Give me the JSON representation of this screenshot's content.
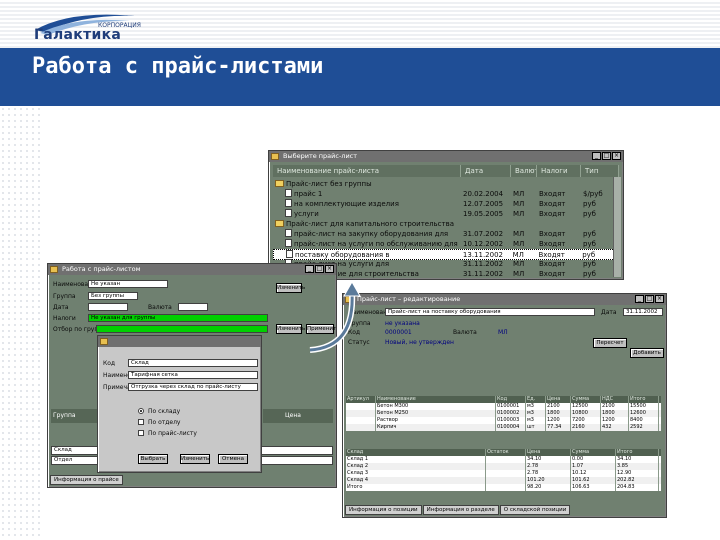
{
  "slide": {
    "logo_small": "КОРПОРАЦИЯ",
    "logo_text": "Галактика",
    "title": "Работа с прайс-листами"
  },
  "price_window": {
    "title": "Выберите прайс-лист",
    "columns": [
      "Наименование прайс-листа",
      "Дата",
      "Валюта",
      "Налоги",
      "Тип"
    ],
    "rows": [
      {
        "kind": "folder",
        "name": "Прайс-лист без группы",
        "date": "",
        "cur": "",
        "tax": "",
        "type": ""
      },
      {
        "kind": "doc",
        "name": "прайс 1",
        "date": "20.02.2004",
        "cur": "МЛ",
        "tax": "Входят",
        "type": "$/руб"
      },
      {
        "kind": "doc",
        "name": "на комплектующие изделия",
        "date": "12.07.2005",
        "cur": "МЛ",
        "tax": "Входят",
        "type": "руб"
      },
      {
        "kind": "doc",
        "name": "услуги",
        "date": "19.05.2005",
        "cur": "МЛ",
        "tax": "Входят",
        "type": "руб"
      },
      {
        "kind": "folder",
        "name": "Прайс-лист для капитального строительства",
        "date": "",
        "cur": "",
        "tax": "",
        "type": ""
      },
      {
        "kind": "doc",
        "name": "прайс-лист на закупку оборудования для",
        "date": "31.07.2002",
        "cur": "МЛ",
        "tax": "Входят",
        "type": "руб"
      },
      {
        "kind": "doc",
        "name": "прайс-лист на услуги по обслуживанию для",
        "date": "10.12.2002",
        "cur": "МЛ",
        "tax": "Входят",
        "type": "руб"
      },
      {
        "kind": "doc",
        "name": "поставку оборудования в",
        "date": "13.11.2002",
        "cur": "МЛ",
        "tax": "Входят",
        "type": "руб"
      },
      {
        "kind": "doc",
        "name": "прайс-лист на услуги для",
        "date": "31.11.2002",
        "cur": "МЛ",
        "tax": "Входят",
        "type": "руб"
      },
      {
        "kind": "doc",
        "name": "оборудование для строительства",
        "date": "31.11.2002",
        "cur": "МЛ",
        "tax": "Входят",
        "type": "руб"
      }
    ]
  },
  "left_window": {
    "title": "Работа с прайс-листом",
    "lbl_name": "Наименование",
    "val_name": "Не указан",
    "lbl_group": "Группа",
    "val_group": "Без группы",
    "lbl_date": "Дата",
    "lbl_cur": "Валюта",
    "lbl_tax": "Налоги",
    "lbl_list": "Прайс-лист",
    "val_list": "Не указан для группы",
    "lbl_groups": "Отбор по группам",
    "btn_edit": "Изменить",
    "btn_apply": "Применить",
    "small_cols": [
      "Группа",
      "Цена"
    ],
    "bottom_rows": [
      "Склад",
      "Отдел"
    ],
    "status_tab": "Информация о прайсе"
  },
  "dialog": {
    "lbl_code": "Код",
    "val_code": "Склад",
    "lbl_name": "Наименование",
    "val_name": "Тарифная сетка",
    "lbl_note": "Примечание",
    "val_note": "Отгрузка через склад по прайс-листу",
    "opt1": "По складу",
    "opt2": "По отделу",
    "opt3": "По прайс-листу",
    "btn_ok": "Выбрать",
    "btn_edit": "Изменить",
    "btn_cancel": "Отмена"
  },
  "right_window": {
    "title": "Прайс-лист – редактирование",
    "lbl_name": "Наименование",
    "val_name": "Прайс-лист на поставку оборудования",
    "lbl_code": "Код",
    "val_code": "0000001",
    "lbl_cur": "Валюта",
    "val_cur": "МЛ",
    "lbl_status": "Статус",
    "val_status": "Новый, не утвержден",
    "lbl_group": "Группа",
    "val_group": "не указана",
    "lbl_date": "Дата",
    "val_date": "31.11.2002",
    "btn1": "Пересчет",
    "btn2": "Добавить",
    "top_cols": [
      "Артикул",
      "Наименование",
      "Код",
      "Ед.",
      "Цена",
      "Сумма",
      "НДС",
      "Итого"
    ],
    "top_rows": [
      [
        "",
        "Бетон М300",
        "0100001",
        "м3",
        "2100",
        "12500",
        "2100",
        "15500"
      ],
      [
        "",
        "Бетон М250",
        "0100002",
        "м3",
        "1800",
        "10800",
        "1800",
        "12600"
      ],
      [
        "",
        "Раствор",
        "0100003",
        "м3",
        "1200",
        "7200",
        "1200",
        "8400"
      ],
      [
        "",
        "Кирпич",
        "0100004",
        "шт",
        "77.34",
        "2160",
        "432",
        "2592"
      ]
    ],
    "bottom_cols": [
      "Склад",
      "Остаток",
      "Цена",
      "Сумма",
      "Итого"
    ],
    "bottom_rows": [
      [
        "Склад 1",
        "",
        "34.10",
        "0.00",
        "34.10"
      ],
      [
        "Склад 2",
        "",
        "2.78",
        "1.07",
        "3.85"
      ],
      [
        "Склад 3",
        "",
        "2.78",
        "10.12",
        "12.90"
      ],
      [
        "Склад 4",
        "",
        "101.20",
        "101.62",
        "202.82"
      ],
      [
        "Итого",
        "",
        "98.20",
        "106.63",
        "204.83"
      ]
    ],
    "tabs": [
      "Информация о позиции",
      "Информация о разделе",
      "О складской позиции"
    ]
  }
}
